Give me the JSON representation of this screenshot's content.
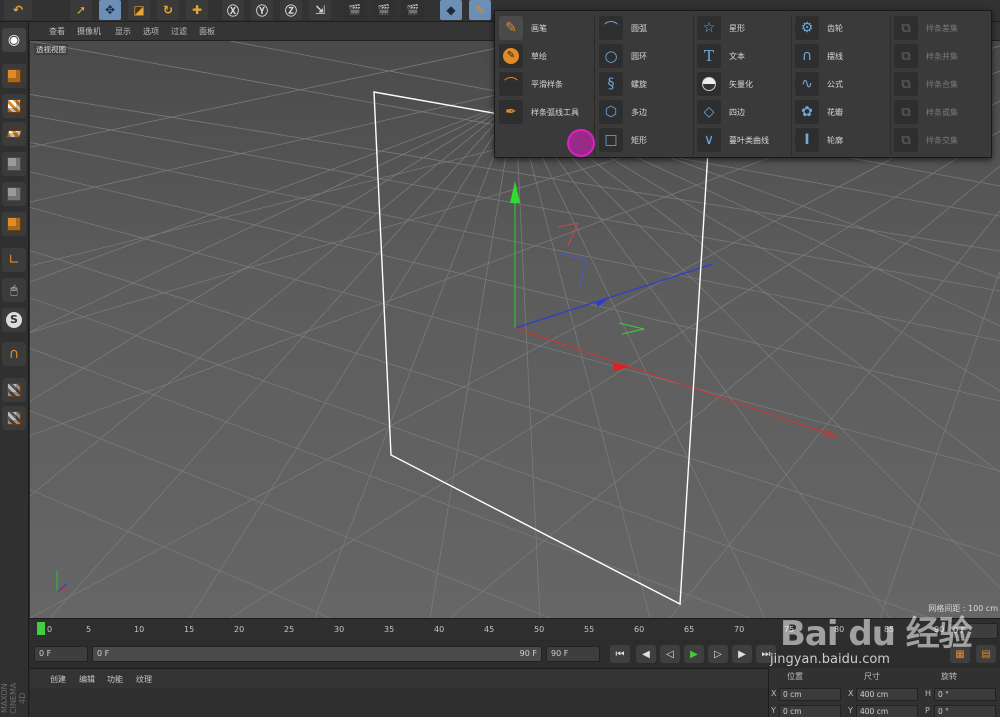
{
  "viewport": {
    "menu": [
      "查看",
      "摄像机",
      "显示",
      "选项",
      "过滤",
      "面板"
    ],
    "label": "透视视图",
    "grid_info": "网格间距 : 100 cm"
  },
  "spline_popup": {
    "col1": [
      "画笔",
      "草绘",
      "平滑样条",
      "样条弧线工具"
    ],
    "col2": [
      "圆弧",
      "圆环",
      "螺旋",
      "多边",
      "矩形"
    ],
    "col3": [
      "星形",
      "文本",
      "矢量化",
      "四边",
      "蔓叶类曲线"
    ],
    "col4": [
      "齿轮",
      "摆线",
      "公式",
      "花瓣",
      "轮廓"
    ],
    "col5": [
      "样条差集",
      "样条并集",
      "样条合集",
      "样条或集",
      "样条交集"
    ]
  },
  "timeline": {
    "ticks": [
      "0",
      "5",
      "10",
      "15",
      "20",
      "25",
      "30",
      "35",
      "40",
      "45",
      "50",
      "55",
      "60",
      "65",
      "70",
      "75",
      "80",
      "85",
      "90"
    ],
    "current_frame": "0 F",
    "start_field": "0 F",
    "range_start": "0 F",
    "range_end": "90 F",
    "end_field": "90 F"
  },
  "bottom_menu": [
    "创建",
    "编辑",
    "功能",
    "纹理"
  ],
  "coords": {
    "headers": [
      "位置",
      "尺寸",
      "旋转"
    ],
    "row1": {
      "axis1": "X",
      "val1": "0 cm",
      "axis2": "X",
      "val2": "400 cm",
      "axis3": "H",
      "val3": "0 °"
    },
    "row2": {
      "axis1": "Y",
      "val1": "0 cm",
      "axis2": "Y",
      "val2": "400 cm",
      "axis3": "P",
      "val3": "0 °"
    }
  },
  "side_tag": "MAXON CINEMA 4D",
  "watermark": {
    "logo": "Bai du 经验",
    "url": "jingyan.baidu.com"
  }
}
